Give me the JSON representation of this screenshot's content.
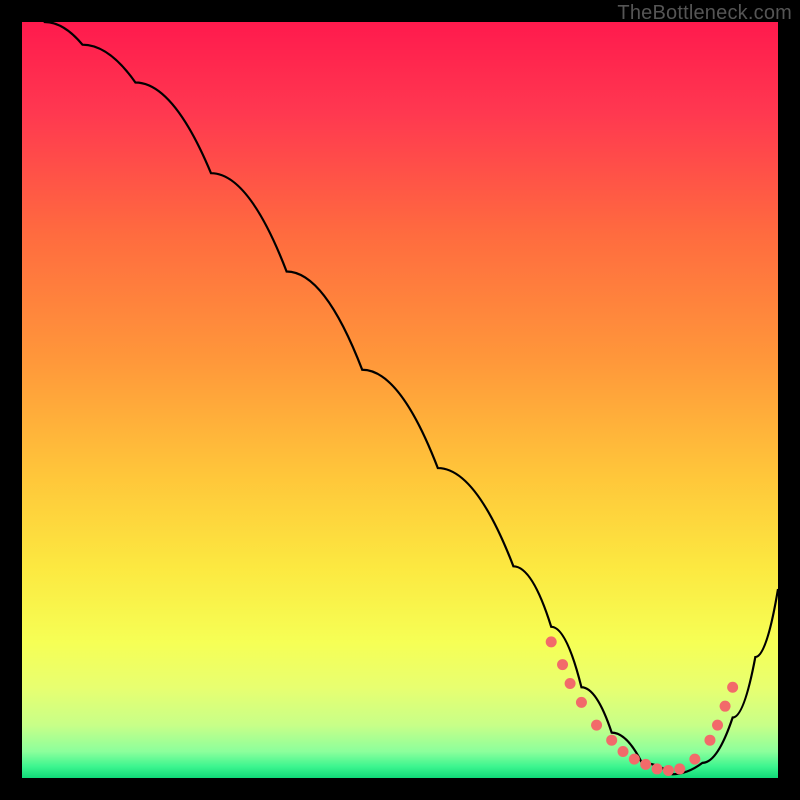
{
  "attribution": "TheBottleneck.com",
  "chart_data": {
    "type": "line",
    "title": "",
    "xlabel": "",
    "ylabel": "",
    "xlim": [
      0,
      100
    ],
    "ylim": [
      0,
      100
    ],
    "series": [
      {
        "name": "bottleneck-curve",
        "x": [
          0,
          3,
          8,
          15,
          25,
          35,
          45,
          55,
          65,
          70,
          74,
          78,
          82,
          86,
          90,
          94,
          97,
          100
        ],
        "y": [
          102,
          100,
          97,
          92,
          80,
          67,
          54,
          41,
          28,
          20,
          12,
          6,
          2,
          0.5,
          2,
          8,
          16,
          25
        ]
      }
    ],
    "markers": {
      "name": "highlight-dots",
      "color": "#f26a6a",
      "x": [
        70,
        71.5,
        72.5,
        74,
        76,
        78,
        79.5,
        81,
        82.5,
        84,
        85.5,
        87,
        89,
        91,
        92,
        93,
        94
      ],
      "y": [
        18,
        15,
        12.5,
        10,
        7,
        5,
        3.5,
        2.5,
        1.8,
        1.2,
        1,
        1.2,
        2.5,
        5,
        7,
        9.5,
        12
      ]
    },
    "background_gradient": [
      {
        "offset": 0.0,
        "color": "#ff1a4d"
      },
      {
        "offset": 0.12,
        "color": "#ff3850"
      },
      {
        "offset": 0.28,
        "color": "#ff6b3f"
      },
      {
        "offset": 0.45,
        "color": "#ff983a"
      },
      {
        "offset": 0.6,
        "color": "#ffc63a"
      },
      {
        "offset": 0.72,
        "color": "#fce840"
      },
      {
        "offset": 0.82,
        "color": "#f6ff55"
      },
      {
        "offset": 0.88,
        "color": "#e8ff70"
      },
      {
        "offset": 0.93,
        "color": "#c8ff88"
      },
      {
        "offset": 0.965,
        "color": "#8cff9c"
      },
      {
        "offset": 0.985,
        "color": "#3cf58f"
      },
      {
        "offset": 1.0,
        "color": "#10d978"
      }
    ]
  }
}
